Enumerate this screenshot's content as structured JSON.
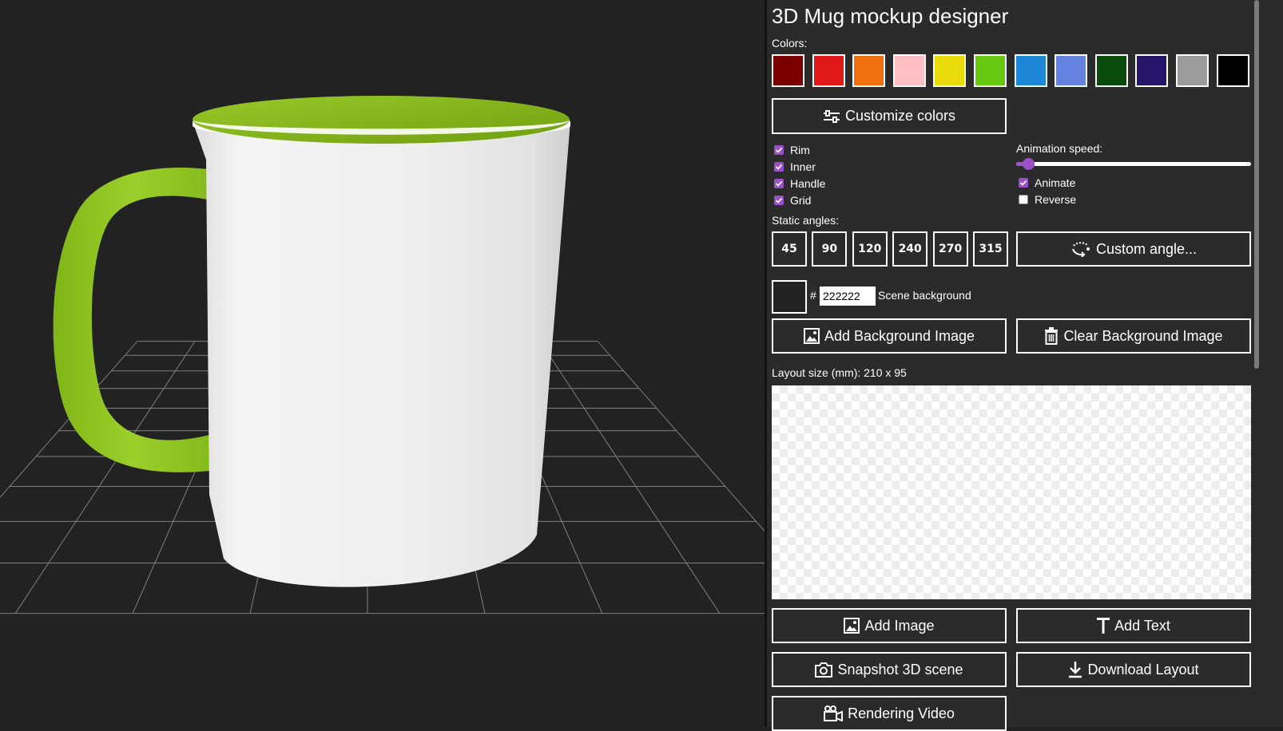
{
  "app": {
    "title": "3D Mug mockup designer"
  },
  "colors": {
    "label": "Colors:",
    "swatches": [
      {
        "name": "maroon",
        "hex": "#7a0000"
      },
      {
        "name": "red",
        "hex": "#e01818"
      },
      {
        "name": "orange",
        "hex": "#f07010"
      },
      {
        "name": "pink",
        "hex": "#ffbfc4"
      },
      {
        "name": "yellow",
        "hex": "#eadc0a"
      },
      {
        "name": "lime",
        "hex": "#66c80f"
      },
      {
        "name": "blue",
        "hex": "#1e88d8"
      },
      {
        "name": "periwinkle",
        "hex": "#6482e0"
      },
      {
        "name": "dark-green",
        "hex": "#0a4a0a"
      },
      {
        "name": "indigo",
        "hex": "#26156b"
      },
      {
        "name": "gray",
        "hex": "#9b9b9b"
      },
      {
        "name": "black",
        "hex": "#000000"
      }
    ],
    "customize_label": "Customize colors"
  },
  "parts": [
    {
      "label": "Rim",
      "checked": true
    },
    {
      "label": "Inner",
      "checked": true
    },
    {
      "label": "Handle",
      "checked": true
    },
    {
      "label": "Grid",
      "checked": true
    }
  ],
  "animation": {
    "label": "Animation speed:",
    "speed_fraction": 0.05,
    "options": [
      {
        "label": "Animate",
        "checked": true
      },
      {
        "label": "Reverse",
        "checked": false
      }
    ]
  },
  "static_angles": {
    "label": "Static angles:",
    "angles": [
      "45",
      "90",
      "120",
      "240",
      "270",
      "315"
    ],
    "custom_label": "Custom angle..."
  },
  "scene_background": {
    "hash": "#",
    "hex": "222222",
    "label": "Scene background"
  },
  "buttons": {
    "add_bg_image": "Add Background Image",
    "clear_bg_image": "Clear Background Image",
    "add_image": "Add Image",
    "add_text": "Add Text",
    "snapshot": "Snapshot 3D scene",
    "download_layout": "Download Layout",
    "rendering_video": "Rendering Video"
  },
  "layout": {
    "size_label": "Layout size (mm): 210 x 95"
  },
  "mug": {
    "body_color": "#f2f2f2",
    "accent_color": "#8cc21a"
  },
  "theme": {
    "accent": "#9b4fc9",
    "panel_bg": "#2b2b2b",
    "scene_bg": "#222222"
  }
}
